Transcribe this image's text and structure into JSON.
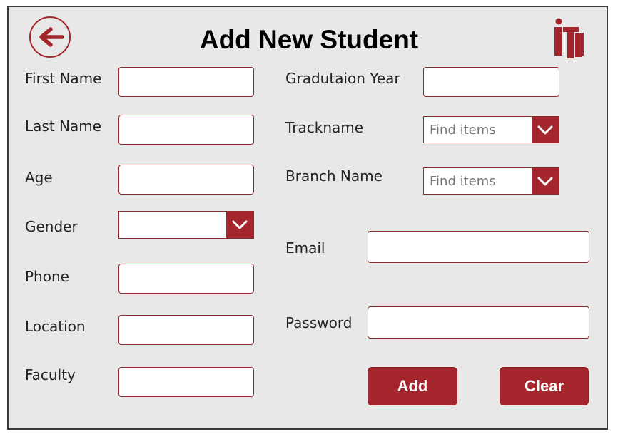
{
  "page": {
    "title": "Add New Student"
  },
  "colors": {
    "accent": "#a4262c",
    "background": "#e8e8e8",
    "field_border": "#8b2b2b"
  },
  "icons": {
    "back": "back-arrow-icon",
    "logo": "iti-logo",
    "dropdown": "chevron-down-icon"
  },
  "form": {
    "first_name": {
      "label": "First Name",
      "value": ""
    },
    "last_name": {
      "label": "Last Name",
      "value": ""
    },
    "age": {
      "label": "Age",
      "value": ""
    },
    "gender": {
      "label": "Gender",
      "selected": ""
    },
    "phone": {
      "label": "Phone",
      "value": ""
    },
    "location": {
      "label": "Location",
      "value": ""
    },
    "faculty": {
      "label": "Faculty",
      "value": ""
    },
    "graduation_year": {
      "label": "Gradutaion Year",
      "value": ""
    },
    "trackname": {
      "label": "Trackname",
      "placeholder": "Find items"
    },
    "branch_name": {
      "label": "Branch Name",
      "placeholder": "Find items"
    },
    "email": {
      "label": "Email",
      "value": ""
    },
    "password": {
      "label": "Password",
      "value": ""
    }
  },
  "actions": {
    "add_label": "Add",
    "clear_label": "Clear"
  }
}
